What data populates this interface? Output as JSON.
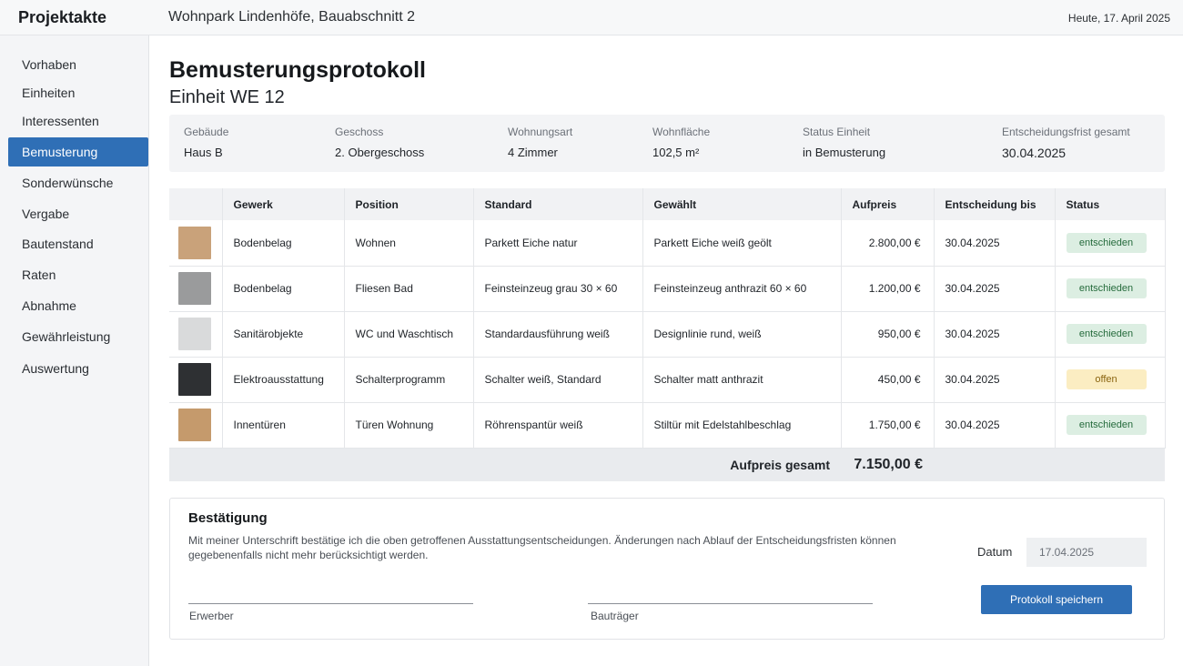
{
  "app": {
    "title": "Projektakte",
    "project": "Wohnpark Lindenhöfe, Bauabschnitt 2",
    "today": "Heute, 17. April 2025"
  },
  "sidebar": {
    "items": [
      {
        "label": "Vorhaben",
        "active": false
      },
      {
        "label": "Einheiten",
        "active": false
      },
      {
        "label": "Interessenten",
        "active": false
      },
      {
        "label": "Bemusterung",
        "active": true
      },
      {
        "label": "Sonderwünsche",
        "active": false
      },
      {
        "label": "Vergabe",
        "active": false
      },
      {
        "label": "Bautenstand",
        "active": false
      },
      {
        "label": "Raten",
        "active": false
      },
      {
        "label": "Abnahme",
        "active": false
      },
      {
        "label": "Gewährleistung",
        "active": false
      },
      {
        "label": "Auswertung",
        "active": false
      }
    ]
  },
  "page": {
    "title": "Bemusterungsprotokoll",
    "subtitle": "Einheit WE 12"
  },
  "info": {
    "gebaeude_label": "Gebäude",
    "gebaeude": "Haus B",
    "geschoss_label": "Geschoss",
    "geschoss": "2. Obergeschoss",
    "wohnungsart_label": "Wohnungsart",
    "wohnungsart": "4 Zimmer",
    "wohnflaeche_label": "Wohnfläche",
    "wohnflaeche": "102,5 m²",
    "status_label": "Status Einheit",
    "status": "in Bemusterung",
    "frist_label": "Entscheidungsfrist gesamt",
    "frist": "30.04.2025"
  },
  "table": {
    "headers": {
      "thumb": "",
      "gewerk": "Gewerk",
      "position": "Position",
      "standard": "Standard",
      "gewaehlt": "Gewählt",
      "aufpreis": "Aufpreis",
      "entscheidung": "Entscheidung bis",
      "status": "Status"
    },
    "rows": [
      {
        "swatch_color": "#c9a27a",
        "gewerk": "Bodenbelag",
        "position": "Wohnen",
        "standard": "Parkett Eiche natur",
        "gewaehlt": "Parkett Eiche weiß geölt",
        "aufpreis": "2.800,00 €",
        "entscheidung": "30.04.2025",
        "status": "entschieden",
        "status_kind": "done"
      },
      {
        "swatch_color": "#9a9b9c",
        "gewerk": "Bodenbelag",
        "position": "Fliesen Bad",
        "standard": "Feinsteinzeug grau 30 × 60",
        "gewaehlt": "Feinsteinzeug anthrazit 60 × 60",
        "aufpreis": "1.200,00 €",
        "entscheidung": "30.04.2025",
        "status": "entschieden",
        "status_kind": "done"
      },
      {
        "swatch_color": "#d9dadb",
        "gewerk": "Sanitärobjekte",
        "position": "WC und Waschtisch",
        "standard": "Standardausführung weiß",
        "gewaehlt": "Designlinie rund, weiß",
        "aufpreis": "950,00 €",
        "entscheidung": "30.04.2025",
        "status": "entschieden",
        "status_kind": "done"
      },
      {
        "swatch_color": "#2e3033",
        "gewerk": "Elektroausstattung",
        "position": "Schalterprogramm",
        "standard": "Schalter weiß, Standard",
        "gewaehlt": "Schalter matt anthrazit",
        "aufpreis": "450,00 €",
        "entscheidung": "30.04.2025",
        "status": "offen",
        "status_kind": "open"
      },
      {
        "swatch_color": "#c59a6c",
        "gewerk": "Innentüren",
        "position": "Türen Wohnung",
        "standard": "Röhrenspantür weiß",
        "gewaehlt": "Stiltür mit Edelstahlbeschlag",
        "aufpreis": "1.750,00 €",
        "entscheidung": "30.04.2025",
        "status": "entschieden",
        "status_kind": "done"
      }
    ],
    "total_label": "Aufpreis gesamt",
    "total_value": "7.150,00 €"
  },
  "confirm": {
    "title": "Bestätigung",
    "text": "Mit meiner Unterschrift bestätige ich die oben getroffenen Ausstattungsentscheidungen. Änderungen nach Ablauf der Entscheidungsfristen können gegebenenfalls nicht mehr berücksichtigt werden.",
    "erwerber_label": "Erwerber",
    "bautraeger_label": "Bauträger",
    "date_label": "Datum",
    "date_value": "17.04.2025",
    "save_label": "Protokoll speichern"
  }
}
